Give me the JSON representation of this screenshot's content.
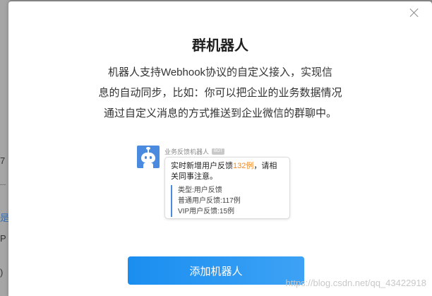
{
  "background": {
    "fragments": [
      "7",
      "...",
      "是",
      "P",
      ")"
    ]
  },
  "dialog": {
    "title": "群机器人",
    "description_lines": [
      "机器人支持Webhook协议的自定义接入，实现信",
      "息的自动同步，比如：你可以把企业的业务数据情况",
      "通过自定义消息的方式推送到企业微信的群聊中。"
    ],
    "preview": {
      "bot_name": "业务反馈机器人",
      "bot_tag": "BOT",
      "message_prefix": "实时新增用户反馈",
      "message_highlight": "132例",
      "message_suffix": "，请相关同事注意。",
      "list_items": [
        "类型:用户反馈",
        "普通用户反馈:117例",
        "VIP用户反馈:15例"
      ]
    },
    "add_button_label": "添加机器人"
  },
  "watermark": "https://blog.csdn.net/qq_43422918",
  "colors": {
    "accent": "#1a8ef0",
    "highlight": "#f5891f"
  }
}
